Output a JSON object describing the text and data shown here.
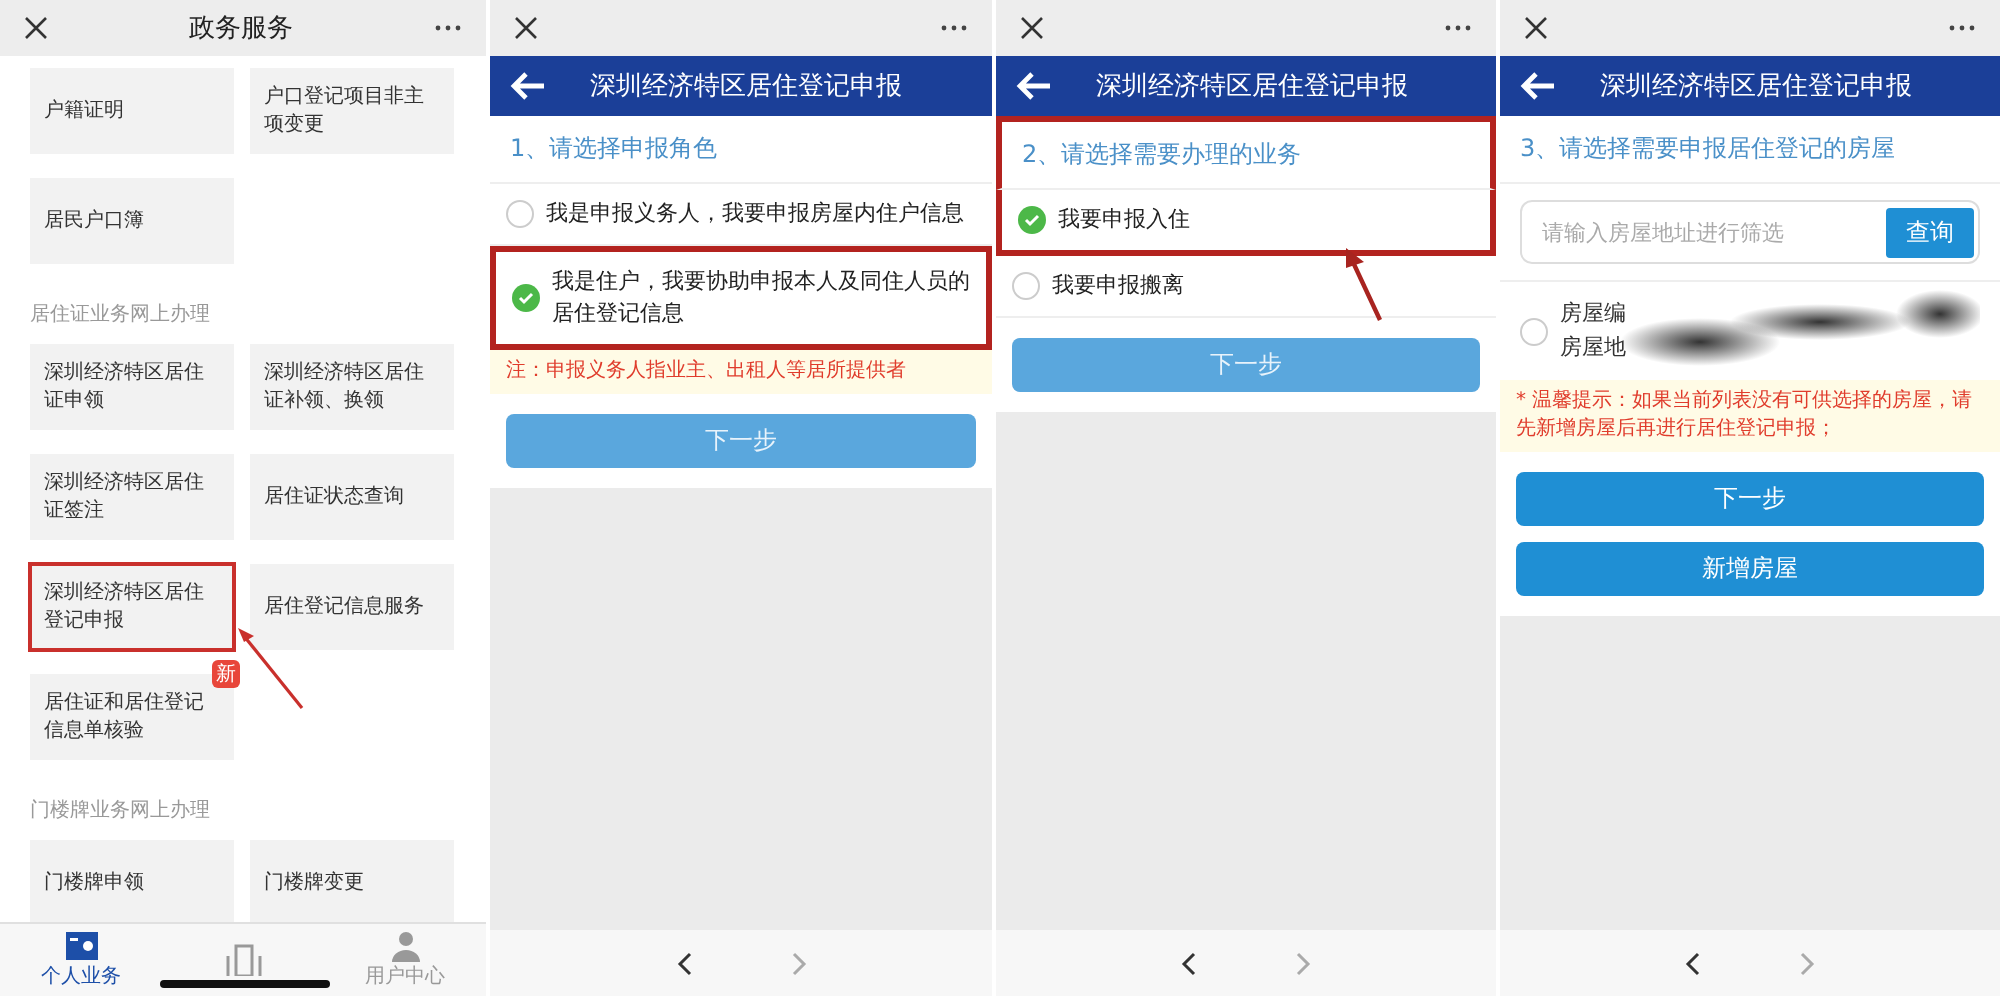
{
  "panels": [
    {
      "kind": "service_list",
      "header": {
        "title": "政务服务"
      },
      "arrow": true,
      "sections": [
        {
          "tiles": [
            {
              "text": "户籍证明",
              "highlighted": false
            },
            {
              "text": "户口登记项目非主项变更",
              "highlighted": false
            },
            {
              "text": "居民户口簿",
              "highlighted": false
            }
          ]
        },
        {
          "label": "居住证业务网上办理",
          "tiles": [
            {
              "text": "深圳经济特区居住证申领",
              "highlighted": false
            },
            {
              "text": "深圳经济特区居住证补领、换领",
              "highlighted": false
            },
            {
              "text": "深圳经济特区居住证签注",
              "highlighted": false
            },
            {
              "text": "居住证状态查询",
              "highlighted": false
            },
            {
              "text": "深圳经济特区居住登记申报",
              "highlighted": true
            },
            {
              "text": "居住登记信息服务",
              "highlighted": false
            },
            {
              "text": "居住证和居住登记信息单核验",
              "highlighted": false,
              "badge": "新"
            }
          ]
        },
        {
          "label": "门楼牌业务网上办理",
          "tiles": [
            {
              "text": "门楼牌申领",
              "highlighted": false
            },
            {
              "text": "门楼牌变更",
              "highlighted": false
            }
          ]
        }
      ],
      "tabbar": [
        {
          "label": "个人业务",
          "selected": true
        },
        {
          "selected": false
        },
        {
          "label": "用户中心",
          "selected": false
        }
      ]
    },
    {
      "kind": "form",
      "title": "深圳经济特区居住登记申报",
      "arrow": false,
      "step": "1、请选择申报角色",
      "step_highlighted": false,
      "options": [
        {
          "text": "我是申报义务人，我要申报房屋内住户信息",
          "selected": false,
          "highlighted": false
        },
        {
          "text": "我是住户，我要协助申报本人及同住人员的居住登记信息",
          "selected": true,
          "highlighted": true
        }
      ],
      "note": "注：申报义务人指业主、出租人等居所提供者",
      "buttons": [
        {
          "label": "下一步",
          "disabled": true
        }
      ]
    },
    {
      "kind": "form",
      "title": "深圳经济特区居住登记申报",
      "arrow": true,
      "step": "2、请选择需要办理的业务",
      "step_highlighted": true,
      "options": [
        {
          "text": "我要申报入住",
          "selected": true,
          "highlighted": true
        },
        {
          "text": "我要申报搬离",
          "selected": false,
          "highlighted": false
        }
      ],
      "buttons": [
        {
          "label": "下一步",
          "disabled": true
        }
      ]
    },
    {
      "kind": "form",
      "title": "深圳经济特区居住登记申报",
      "arrow": false,
      "step": "3、请选择需要申报居住登记的房屋",
      "step_highlighted": false,
      "search": {
        "placeholder": "请输入房屋地址进行筛选",
        "button": "查询"
      },
      "houses": [
        {
          "lines": [
            "房屋编",
            "房屋地"
          ],
          "selected": false
        }
      ],
      "note": "* 温馨提示：如果当前列表没有可供选择的房屋，请先新增房屋后再进行居住登记申报；",
      "buttons": [
        {
          "label": "下一步",
          "disabled": false
        },
        {
          "label": "新增房屋",
          "disabled": false
        }
      ]
    }
  ]
}
